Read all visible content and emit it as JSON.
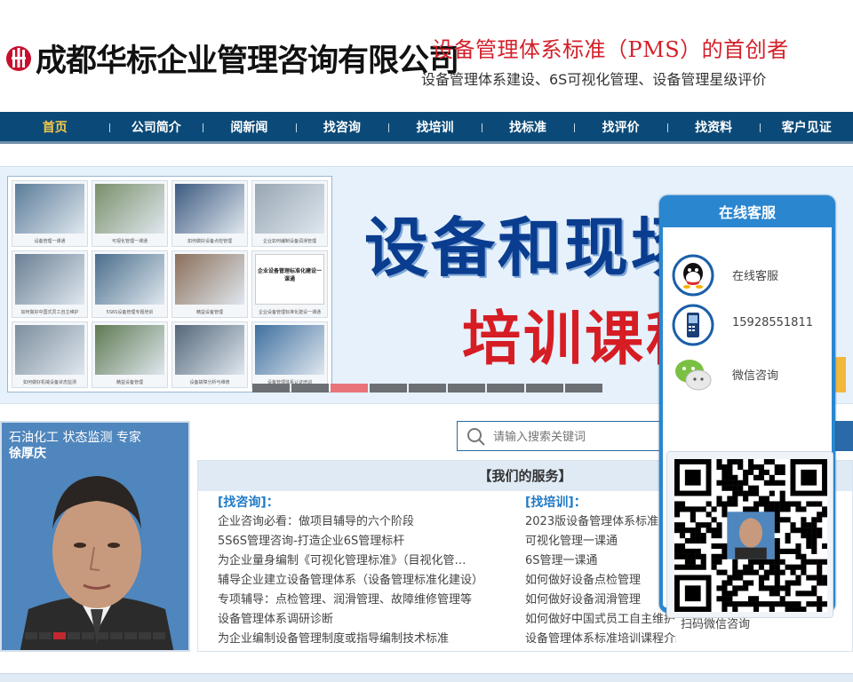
{
  "header": {
    "company_name": "成都华标企业管理咨询有限公司",
    "slogan_primary": "设备管理体系标准（PMS）的首创者",
    "slogan_secondary": "设备管理体系建设、6S可视化管理、设备管理星级评价"
  },
  "nav": {
    "items": [
      {
        "label": "首页",
        "active": true
      },
      {
        "label": "公司简介"
      },
      {
        "label": "阅新闻"
      },
      {
        "label": "找咨询"
      },
      {
        "label": "找培训"
      },
      {
        "label": "找标准"
      },
      {
        "label": "找评价"
      },
      {
        "label": "找资料"
      },
      {
        "label": "客户见证"
      }
    ]
  },
  "banner": {
    "title_line1": "设备和现场",
    "title_line2": "培训课程",
    "accent_blue": "#0a3d8f",
    "accent_red": "#d61d24",
    "active_slide": 3,
    "slide_count": 9,
    "collage_captions": [
      "设备管理一课通",
      "可视化管理一课通",
      "如何做好设备点检管理",
      "企业如何编制设备润滑管理",
      "如何做好中国式员工自主维护",
      "5S6S设备管理专题培训",
      "精益设备管理",
      "企业设备管理标准化建设一课通",
      "如何做好机械设备状态监测",
      "精益设备管理",
      "设备故障分析与维修",
      "设备管理体系认证培训"
    ],
    "collage_doc_title": "企业设备管理标准化建设一课通"
  },
  "expert": {
    "title": "石油化工 状态监测 专家",
    "name": "徐厚庆",
    "active_slide": 3,
    "slide_count": 10
  },
  "search": {
    "placeholder": "请输入搜索关键词"
  },
  "services": {
    "heading": "【我们的服务】",
    "consulting": {
      "heading": "[找咨询]：",
      "items": [
        "企业咨询必看：做项目辅导的六个阶段",
        "5S6S管理咨询-打造企业6S管理标杆",
        "为企业量身编制《可视化管理标准》（目视化管…",
        "辅导企业建立设备管理体系（设备管理标准化建设）",
        "专项辅导：点检管理、润滑管理、故障维修管理等",
        "设备管理体系调研诊断",
        "为企业编制设备管理制度或指导编制技术标准"
      ]
    },
    "training": {
      "heading": "[找培训]：",
      "items": [
        "2023版设备管理体系标准",
        "可视化管理一课通",
        "6S管理一课通",
        "如何做好设备点检管理",
        "如何做好设备润滑管理",
        "如何做好中国式员工自主维护",
        "设备管理体系标准培训课程介绍"
      ]
    }
  },
  "kefu": {
    "heading": "在线客服",
    "rows": [
      {
        "icon": "qq-icon",
        "label": "在线客服"
      },
      {
        "icon": "phone-icon",
        "label": "15928551811"
      },
      {
        "icon": "wechat-icon",
        "label": "微信咨询"
      }
    ],
    "qr_caption": "扫码微信咨询",
    "color": "#2a86cf"
  }
}
